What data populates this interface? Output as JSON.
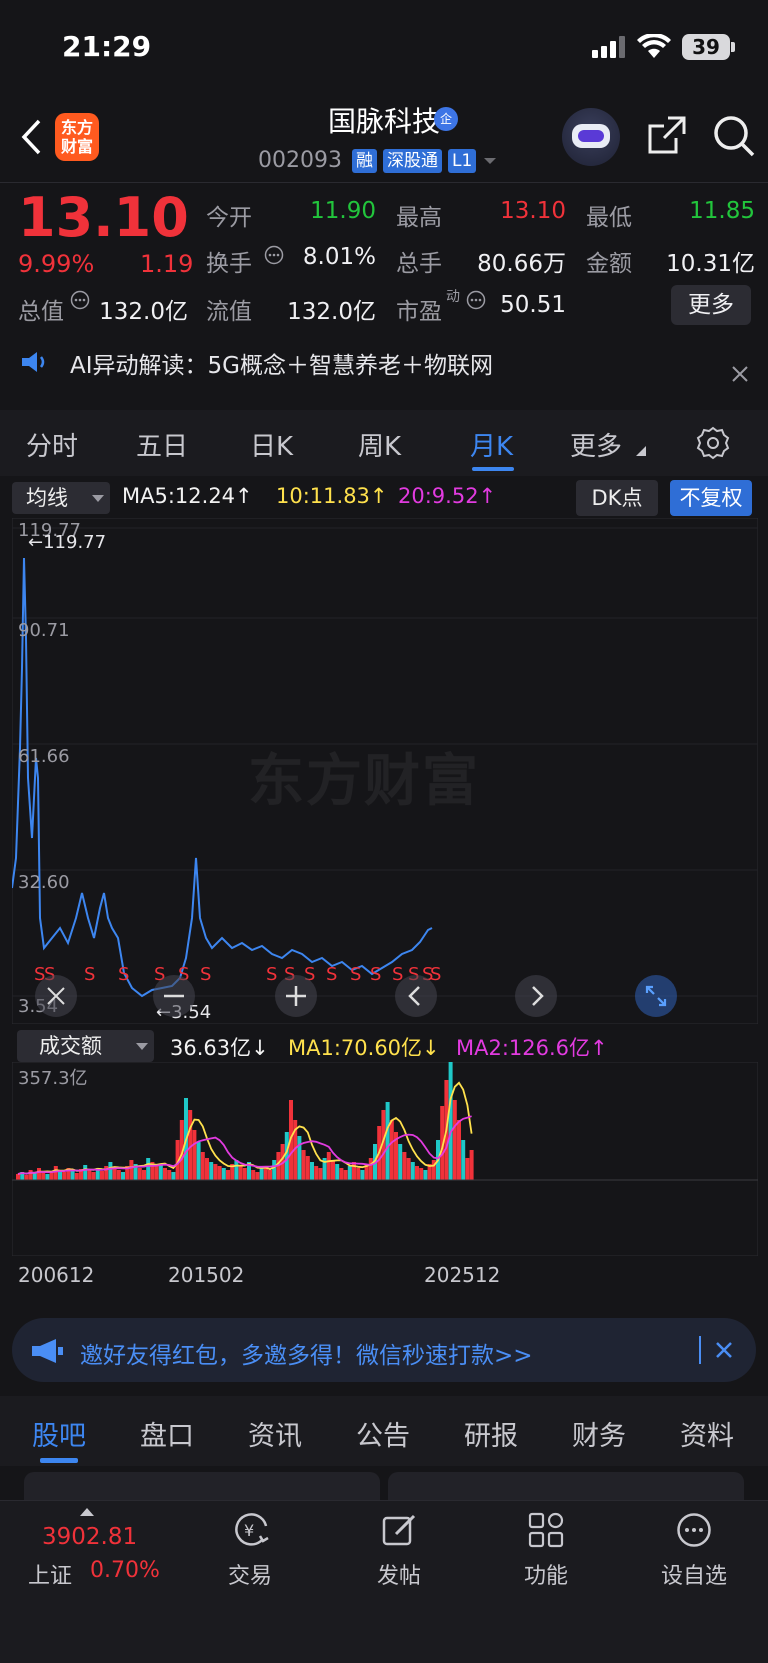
{
  "status_bar": {
    "time": "21:29",
    "battery": "39"
  },
  "header": {
    "logo_text": "东方财富",
    "stock_name": "国脉科技",
    "name_badge": "企",
    "stock_code": "002093",
    "tags": [
      "融",
      "深股通",
      "L1"
    ]
  },
  "quote": {
    "price": "13.10",
    "change_pct": "9.99%",
    "change_amt": "1.19",
    "rows": [
      [
        {
          "label": "今开",
          "value": "11.90",
          "color": "green"
        },
        {
          "label": "最高",
          "value": "13.10",
          "color": "red"
        },
        {
          "label": "最低",
          "value": "11.85",
          "color": "green"
        }
      ],
      [
        {
          "label": "换手",
          "value": "8.01%",
          "color": "white"
        },
        {
          "label": "总手",
          "value": "80.66万",
          "color": "white"
        },
        {
          "label": "金额",
          "value": "10.31亿",
          "color": "white"
        }
      ],
      [
        {
          "label": "流值",
          "value": "132.0亿",
          "color": "white"
        },
        {
          "label": "市盈",
          "value": "50.51",
          "color": "white"
        }
      ]
    ],
    "total_value_label": "总值",
    "total_value": "132.0亿",
    "pe_superscript": "动",
    "more_label": "更多"
  },
  "ai_banner": {
    "text": "AI异动解读：5G概念＋智慧养老＋物联网"
  },
  "period_tabs": [
    "分时",
    "五日",
    "日K",
    "周K",
    "月K",
    "更多"
  ],
  "ma": {
    "selector": "均线",
    "ma5": "MA5:12.24↑",
    "ma10": "10:11.83↑",
    "ma20": "20:9.52↑",
    "dk_label": "DK点",
    "adjust_label": "不复权"
  },
  "chart": {
    "watermark": "东方财富",
    "y_ticks": [
      "119.77",
      "90.71",
      "61.66",
      "32.60",
      "3.54"
    ],
    "max_marker": "119.77",
    "min_marker": "3.54",
    "signal_letter": "S",
    "colors": {
      "line": "#3d86f0",
      "ma5": "#f2f2f2",
      "ma10": "#ffe14d",
      "ma20": "#e23be0"
    }
  },
  "volume": {
    "selector": "成交额",
    "value": "36.63亿↓",
    "ma1": "MA1:70.60亿↓",
    "ma2": "MA2:126.6亿↑",
    "max_label": "357.3亿",
    "dates": [
      "200612",
      "201502",
      "202512"
    ]
  },
  "invite": {
    "text": "邀好友得红包，多邀多得！微信秒速打款>>"
  },
  "content_tabs": [
    "股吧",
    "盘口",
    "资讯",
    "公告",
    "研报",
    "财务",
    "资料"
  ],
  "bottom_nav": {
    "index_value": "3902.81",
    "index_name": "上证",
    "index_change": "0.70%",
    "items": [
      "交易",
      "发帖",
      "功能",
      "设自选"
    ]
  }
}
